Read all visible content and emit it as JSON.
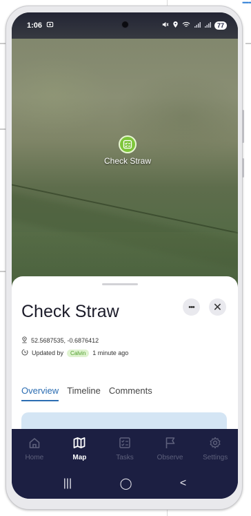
{
  "background": {
    "link_text": "••••••"
  },
  "status_bar": {
    "time": "1:06",
    "battery": "77"
  },
  "map": {
    "marker_label": "Check Straw",
    "marker_color": "#7ec53b"
  },
  "sheet": {
    "title": "Check Straw",
    "coordinates": "52.5687535, -0.6876412",
    "updated_prefix": "Updated by",
    "updated_user": "Calvin",
    "updated_time": "1 minute ago",
    "tabs": [
      {
        "label": "Overview",
        "active": true
      },
      {
        "label": "Timeline",
        "active": false
      },
      {
        "label": "Comments",
        "active": false
      }
    ],
    "accent": "#2b6db2"
  },
  "bottom_nav": {
    "items": [
      {
        "label": "Home",
        "icon": "home-icon"
      },
      {
        "label": "Map",
        "icon": "map-icon",
        "active": true
      },
      {
        "label": "Tasks",
        "icon": "tasks-icon"
      },
      {
        "label": "Observe",
        "icon": "flag-icon"
      },
      {
        "label": "Settings",
        "icon": "gear-icon"
      }
    ]
  },
  "system_nav": {
    "recents": "|||",
    "home": "◯",
    "back": "<"
  }
}
